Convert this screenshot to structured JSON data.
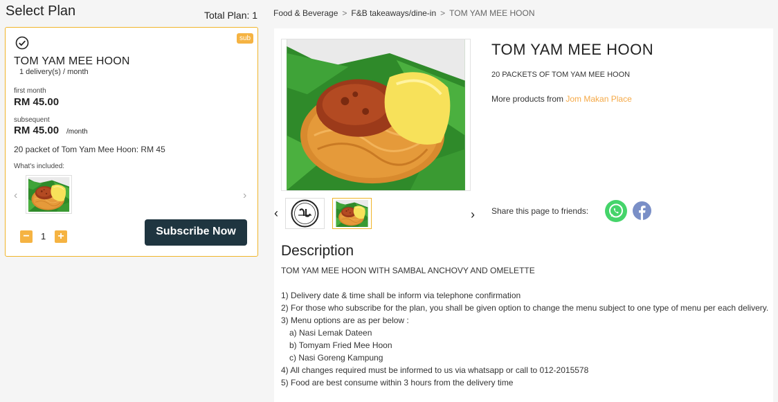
{
  "plan": {
    "section_title": "Select Plan",
    "total_plan": "Total Plan: 1",
    "badge": "sub",
    "name": "TOM YAM MEE HOON",
    "frequency": "1 delivery(s) / month",
    "first_month_label": "first month",
    "first_month_price": "RM 45.00",
    "subsequent_label": "subsequent",
    "subsequent_price": "RM 45.00",
    "per_month": "/month",
    "description": "20 packet of Tom Yam Mee Hoon: RM 45",
    "included_label": "What's included:",
    "quantity": "1",
    "minus": "−",
    "plus": "+",
    "subscribe_label": "Subscribe Now"
  },
  "breadcrumb": {
    "items": [
      "Food & Beverage",
      "F&B takeaways/dine-in",
      "TOM YAM MEE HOON"
    ],
    "separator": ">"
  },
  "product": {
    "title": "TOM YAM MEE HOON",
    "short_desc": "20 PACKETS OF TOM YAM MEE HOON",
    "more_from_label": "More products from ",
    "vendor": "Jom Makan Place",
    "share_label": "Share this page to friends:"
  },
  "description": {
    "title": "Description",
    "lines": [
      "TOM YAM MEE HOON WITH SAMBAL ANCHOVY AND OMELETTE",
      "",
      "1) Delivery date & time shall be inform via telephone confirmation",
      "2) For those who subscribe for the plan, you shall be given option to change the menu subject to one type of menu per each delivery.",
      "3) Menu options are as per below :",
      "a) Nasi Lemak Dateen",
      "b) Tomyam Fried Mee Hoon",
      "c) Nasi Goreng Kampung",
      "4) All changes required must be informed to us via whatsapp or call to 012-2015578",
      "5) Food are best consume within 3 hours from the delivery time"
    ]
  },
  "icons": {
    "check": "check-circle-icon",
    "prev": "chevron-left-icon",
    "next": "chevron-right-icon",
    "whatsapp": "whatsapp-icon",
    "facebook": "facebook-icon",
    "halal": "halal-logo"
  },
  "colors": {
    "accent": "#f5b342",
    "button_dark": "#1f3540",
    "whatsapp": "#45d46a",
    "facebook": "#7a8fc7",
    "link": "#f5a845"
  }
}
